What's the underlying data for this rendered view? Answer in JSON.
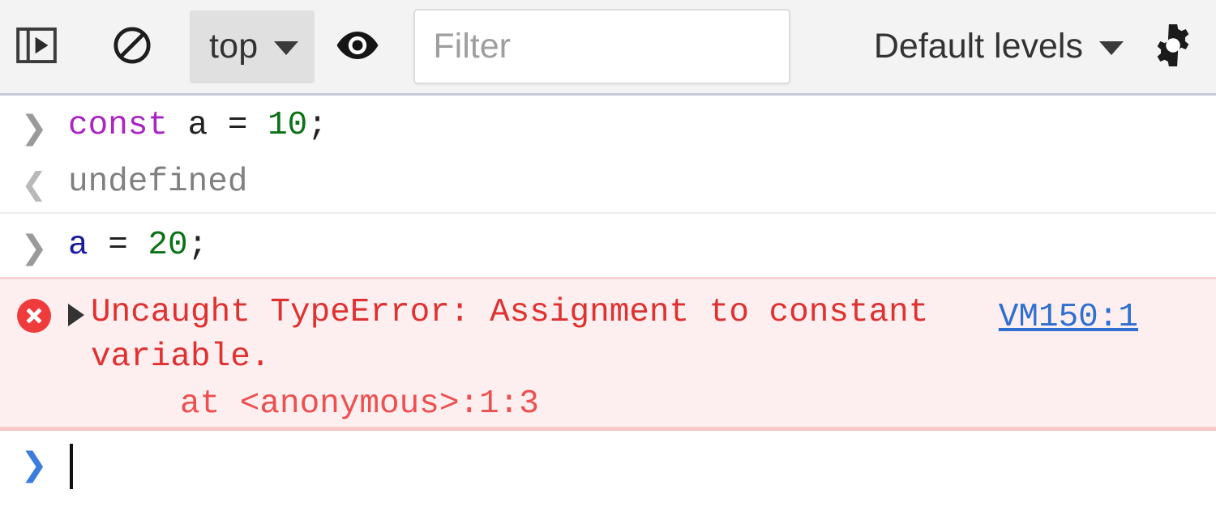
{
  "toolbar": {
    "drawer_toggle": {
      "name": "show-console-sidebar",
      "icon": "sidebar-panel-icon",
      "label": ""
    },
    "clear_console": {
      "name": "clear-console",
      "icon": "no-entry-icon",
      "label": ""
    },
    "context_select": {
      "value": "top",
      "caret": "▼"
    },
    "eye_button": {
      "name": "create-live-expression",
      "icon": "eye-icon",
      "label": ""
    },
    "filter": {
      "value": "",
      "placeholder": "Filter"
    },
    "levels_select": {
      "value": "Default levels",
      "caret": "▼"
    },
    "settings": {
      "name": "console-settings",
      "icon": "gear-icon",
      "label": ""
    }
  },
  "console": {
    "entries": [
      {
        "type": "input",
        "gutter": "❯",
        "tokens": [
          {
            "text": "const",
            "kind": "keyword"
          },
          {
            "text": " ",
            "kind": "plain"
          },
          {
            "text": "a",
            "kind": "plain"
          },
          {
            "text": " = ",
            "kind": "plain"
          },
          {
            "text": "10",
            "kind": "number"
          },
          {
            "text": ";",
            "kind": "punct"
          }
        ],
        "plain": "const a = 10;"
      },
      {
        "type": "output",
        "gutter": "❮",
        "value": "undefined"
      },
      {
        "type": "input",
        "gutter": "❯",
        "tokens": [
          {
            "text": "a",
            "kind": "variable"
          },
          {
            "text": " = ",
            "kind": "plain"
          },
          {
            "text": "20",
            "kind": "number"
          },
          {
            "text": ";",
            "kind": "punct"
          }
        ],
        "plain": "a = 20;"
      }
    ],
    "error": {
      "icon": "error-circle-icon",
      "expand_triangle": "▶",
      "message": "Uncaught TypeError: Assignment to constant variable.",
      "source_link": "VM150:1",
      "stack": "at <anonymous>:1:3"
    },
    "prompt": {
      "gutter": "❯",
      "value": ""
    }
  },
  "colors": {
    "error_red": "#e03131",
    "error_bg": "#fdefef",
    "link_blue": "#2f6fd0",
    "keyword_purple": "#aa25c4",
    "number_green": "#0b7216",
    "variable_blue": "#1a1a9c",
    "toolbar_bg": "#f3f3f3"
  }
}
